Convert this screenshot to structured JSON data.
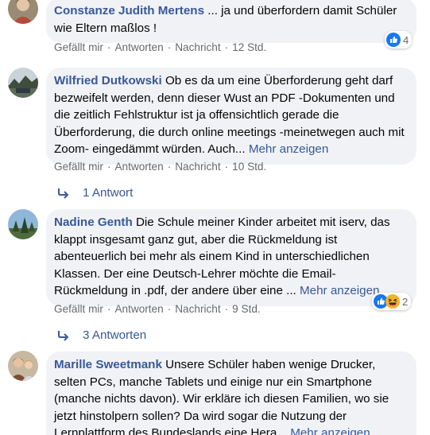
{
  "comments": [
    {
      "author": "Constanze Judith Mertens",
      "text": " ... ja und überfordern damit Schüler wie Eltern maßlos !",
      "more": "",
      "actions": {
        "like": "Gefällt mir",
        "reply": "Antworten",
        "message": "Nachricht",
        "time": "12 Std."
      },
      "reaction_count": "4",
      "reactions": [
        "like-icon"
      ]
    },
    {
      "author": "Wilfried Dutkowski",
      "text": " Ob es da um eine Überforderung geht darf bezweifelt werden, denn dieser Wust an PDF -Dokumenten und die zeitlich Fehlstruktur ist ja offensichtlich gerade die Überforderung, die durch online meetings -meinetwegen auch mit Zoom- eingedämmt würden. Auch...",
      "more": "Mehr anzeigen",
      "actions": {
        "like": "Gefällt mir",
        "reply": "Antworten",
        "message": "Nachricht",
        "time": "10 Std."
      },
      "replies": "1 Antwort"
    },
    {
      "author": "Nadine Genth",
      "text": " Die Schule meiner Kinder arbeitet mit iserv, das klappt insgesamt ganz gut, aber die Rückmeldung ist abenteuerlich bei mehr als einem Kind in unterschiedlichen Klassen. Der eine Deutsch-Lehrer möchte die Email-Rückmeldung in .pdf, der andere über eine ...",
      "more": "Mehr anzeigen",
      "actions": {
        "like": "Gefällt mir",
        "reply": "Antworten",
        "message": "Nachricht",
        "time": "9 Std."
      },
      "reaction_count": "2",
      "reactions": [
        "like-icon",
        "haha-icon"
      ],
      "replies": "3 Antworten"
    },
    {
      "author": "Marille Sweetmank",
      "text": " Unsere Schüler haben wenige Drucker, selten PCs, manche Tablets und einige nur ein Smartphone (manche nichts davon). Wir erkläre ich diesen Familien, wo sie jetzt hinstolpern sollen? Da wird sogar die Nutzung der Lernplattform des Bundeslands eine Hera...",
      "more": "Mehr anzeigen"
    }
  ],
  "colors": {
    "link": "#385898",
    "bubble": "#f0f2f5",
    "meta": "#65676b",
    "like": "#1877f2",
    "haha": "#f7b125"
  },
  "separator": "·"
}
